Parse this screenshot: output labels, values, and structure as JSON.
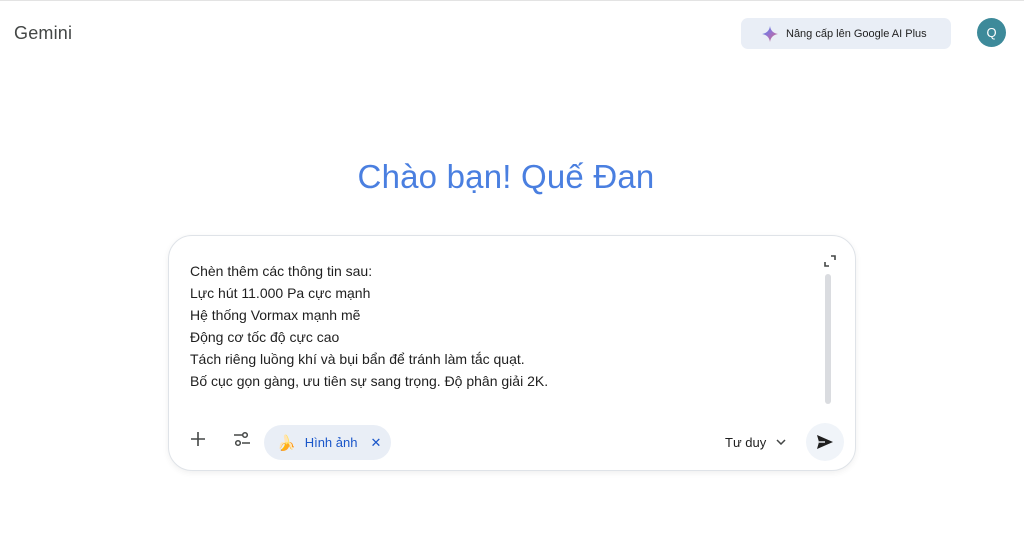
{
  "header": {
    "brand": "Gemini",
    "upgrade_label": "Nâng cấp lên Google AI Plus",
    "avatar_initial": "Q"
  },
  "main": {
    "greeting": "Chào bạn! Quế Đan"
  },
  "composer": {
    "lines": [
      "Chèn thêm các thông tin sau:",
      "Lực hút 11.000 Pa cực mạnh",
      "Hệ thống Vormax mạnh mẽ",
      "Động cơ tốc độ cực cao",
      "Tách riêng luồng khí và bụi bẩn để tránh làm tắc quạt.",
      "Bố cục gọn gàng, ưu tiên sự sang trọng. Độ phân giải 2K."
    ],
    "chip": {
      "icon": "banana-icon",
      "emoji": "🍌",
      "label": "Hình ảnh",
      "close": "✕"
    },
    "mode_label": "Tư duy"
  },
  "colors": {
    "greeting": "#4a7fe0",
    "chip_bg": "#e9eef6",
    "chip_text": "#1a56c9",
    "avatar_bg": "#3d8a9a"
  },
  "icons": [
    "sparkle-icon",
    "expand-icon",
    "plus-icon",
    "tools-icon",
    "banana-icon",
    "close-icon",
    "chevron-down-icon",
    "send-icon"
  ]
}
